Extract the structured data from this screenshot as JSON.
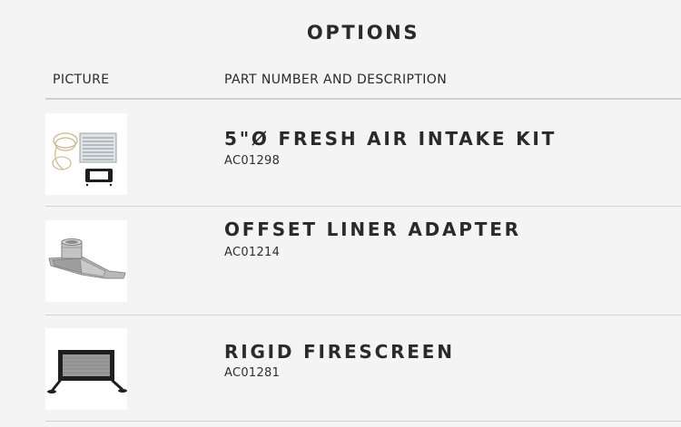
{
  "page": {
    "title": "OPTIONS"
  },
  "table": {
    "headers": {
      "picture": "PICTURE",
      "description": "PART NUMBER AND DESCRIPTION"
    },
    "rows": [
      {
        "name": "5\"Ø FRESH AIR INTAKE KIT",
        "part_number": "AC01298",
        "image": "fresh-air-intake-kit-image"
      },
      {
        "name": "OFFSET LINER ADAPTER",
        "part_number": "AC01214",
        "image": "offset-liner-adapter-image"
      },
      {
        "name": "RIGID FIRESCREEN",
        "part_number": "AC01281",
        "image": "rigid-firescreen-image"
      }
    ]
  },
  "colors": {
    "background": "#f4f4f4",
    "text": "#2a2a2a",
    "rule": "#d3d3d3"
  }
}
